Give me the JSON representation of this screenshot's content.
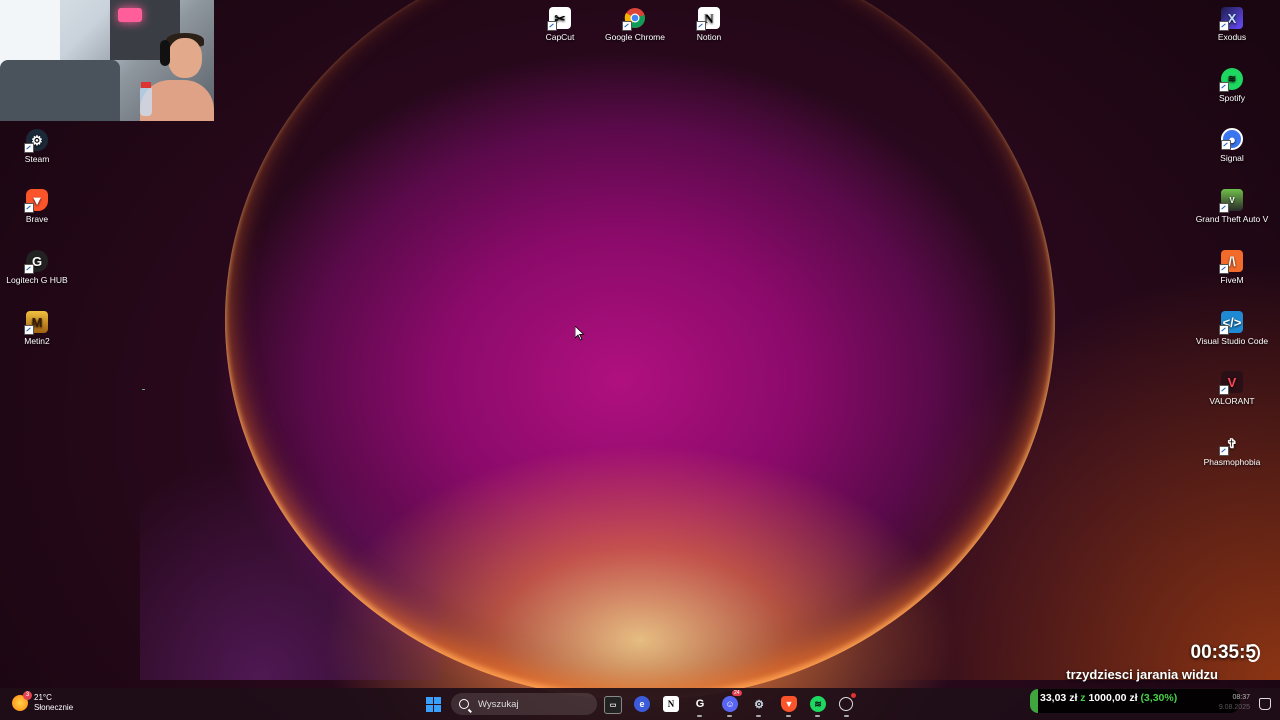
{
  "desktop": {
    "top_icons": [
      {
        "label": "CapCut",
        "icon": "capcut-icon"
      },
      {
        "label": "Google Chrome",
        "icon": "chrome-icon"
      },
      {
        "label": "Notion",
        "icon": "notion-icon"
      }
    ],
    "left_icons": [
      {
        "label": "Steam",
        "icon": "steam-icon"
      },
      {
        "label": "Brave",
        "icon": "brave-icon"
      },
      {
        "label": "Logitech G HUB",
        "icon": "logitech-icon"
      },
      {
        "label": "Metin2",
        "icon": "metin2-icon"
      }
    ],
    "right_icons": [
      {
        "label": "Exodus",
        "icon": "exodus-icon"
      },
      {
        "label": "Spotify",
        "icon": "spotify-icon"
      },
      {
        "label": "Signal",
        "icon": "signal-icon"
      },
      {
        "label": "Grand Theft Auto V",
        "icon": "gta-icon"
      },
      {
        "label": "FiveM",
        "icon": "fivem-icon"
      },
      {
        "label": "Visual Studio Code",
        "icon": "vscode-icon"
      },
      {
        "label": "VALORANT",
        "icon": "valorant-icon"
      },
      {
        "label": "Phasmophobia",
        "icon": "phasmophobia-icon"
      }
    ]
  },
  "overlay": {
    "timer": "00:35:5",
    "caption": "trzydziesci jarania widzu",
    "donation": {
      "current": "33,03 zł",
      "separator": "z",
      "goal": "1000,00 zł",
      "percent_label": "(3,30%)",
      "progress_fraction": 0.033
    }
  },
  "taskbar": {
    "weather": {
      "temp": "21°C",
      "condition": "Słonecznie",
      "badge": "3"
    },
    "search_placeholder": "Wyszukaj",
    "apps": [
      "terminal-icon",
      "edge-icon",
      "notion-icon",
      "logitech-icon",
      "discord-icon",
      "steam-icon",
      "brave-icon",
      "spotify-icon",
      "settings-icon"
    ],
    "discord_badge": "24",
    "clock": {
      "time": "08:37",
      "date": "9.08.2025"
    }
  },
  "colors": {
    "accent": "#3aa0ff",
    "donation_green": "#46d046",
    "spotify": "#1ed760"
  }
}
